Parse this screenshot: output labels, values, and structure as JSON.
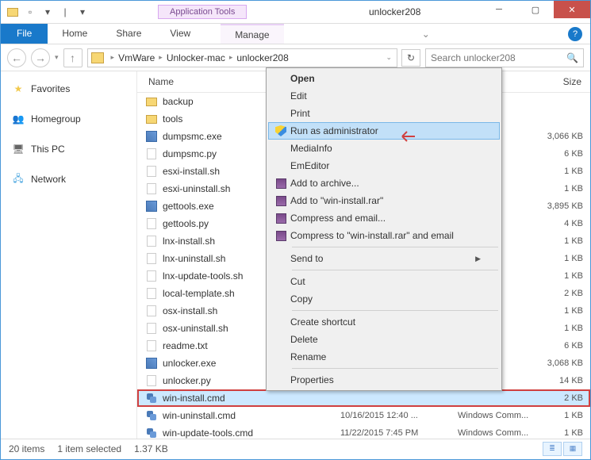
{
  "window": {
    "title": "unlocker208",
    "app_tools": "Application Tools"
  },
  "ribbon": {
    "file": "File",
    "home": "Home",
    "share": "Share",
    "view": "View",
    "manage": "Manage"
  },
  "address": {
    "parts": [
      "VmWare",
      "Unlocker-mac",
      "unlocker208"
    ]
  },
  "search": {
    "placeholder": "Search unlocker208"
  },
  "sidebar": {
    "favorites": "Favorites",
    "homegroup": "Homegroup",
    "thispc": "This PC",
    "network": "Network"
  },
  "columns": {
    "name": "Name",
    "date": "",
    "type": "",
    "size": "Size"
  },
  "files": [
    {
      "icon": "folder",
      "name": "backup",
      "date": "",
      "type": "",
      "size": ""
    },
    {
      "icon": "folder",
      "name": "tools",
      "date": "",
      "type": "",
      "size": ""
    },
    {
      "icon": "exe",
      "name": "dumpsmc.exe",
      "date": "",
      "type": "",
      "size": "3,066 KB"
    },
    {
      "icon": "py",
      "name": "dumpsmc.py",
      "date": "",
      "type": "",
      "size": "6 KB"
    },
    {
      "icon": "sh",
      "name": "esxi-install.sh",
      "date": "",
      "type": "",
      "size": "1 KB"
    },
    {
      "icon": "sh",
      "name": "esxi-uninstall.sh",
      "date": "",
      "type": "",
      "size": "1 KB"
    },
    {
      "icon": "exe",
      "name": "gettools.exe",
      "date": "",
      "type": "",
      "size": "3,895 KB"
    },
    {
      "icon": "py",
      "name": "gettools.py",
      "date": "",
      "type": "",
      "size": "4 KB"
    },
    {
      "icon": "sh",
      "name": "lnx-install.sh",
      "date": "",
      "type": "",
      "size": "1 KB"
    },
    {
      "icon": "sh",
      "name": "lnx-uninstall.sh",
      "date": "",
      "type": "",
      "size": "1 KB"
    },
    {
      "icon": "sh",
      "name": "lnx-update-tools.sh",
      "date": "",
      "type": "",
      "size": "1 KB"
    },
    {
      "icon": "sh",
      "name": "local-template.sh",
      "date": "",
      "type": "",
      "size": "2 KB"
    },
    {
      "icon": "sh",
      "name": "osx-install.sh",
      "date": "",
      "type": "",
      "size": "1 KB"
    },
    {
      "icon": "sh",
      "name": "osx-uninstall.sh",
      "date": "",
      "type": "",
      "size": "1 KB"
    },
    {
      "icon": "txt",
      "name": "readme.txt",
      "date": "",
      "type": "",
      "size": "6 KB"
    },
    {
      "icon": "exe",
      "name": "unlocker.exe",
      "date": "",
      "type": "",
      "size": "3,068 KB"
    },
    {
      "icon": "py",
      "name": "unlocker.py",
      "date": "",
      "type": "",
      "size": "14 KB"
    },
    {
      "icon": "cmd",
      "name": "win-install.cmd",
      "date": "",
      "type": "",
      "size": "2 KB",
      "selected": true
    },
    {
      "icon": "cmd",
      "name": "win-uninstall.cmd",
      "date": "10/16/2015 12:40 ...",
      "type": "Windows Comm...",
      "size": "1 KB"
    },
    {
      "icon": "cmd",
      "name": "win-update-tools.cmd",
      "date": "11/22/2015 7:45 PM",
      "type": "Windows Comm...",
      "size": "1 KB"
    }
  ],
  "context_menu": {
    "open": "Open",
    "edit": "Edit",
    "print": "Print",
    "run_admin": "Run as administrator",
    "mediainfo": "MediaInfo",
    "emeditor": "EmEditor",
    "add_archive": "Add to archive...",
    "add_rar": "Add to \"win-install.rar\"",
    "compress_email": "Compress and email...",
    "compress_rar_email": "Compress to \"win-install.rar\" and email",
    "send_to": "Send to",
    "cut": "Cut",
    "copy": "Copy",
    "create_shortcut": "Create shortcut",
    "delete": "Delete",
    "rename": "Rename",
    "properties": "Properties"
  },
  "status": {
    "items": "20 items",
    "selected": "1 item selected",
    "size": "1.37 KB"
  }
}
